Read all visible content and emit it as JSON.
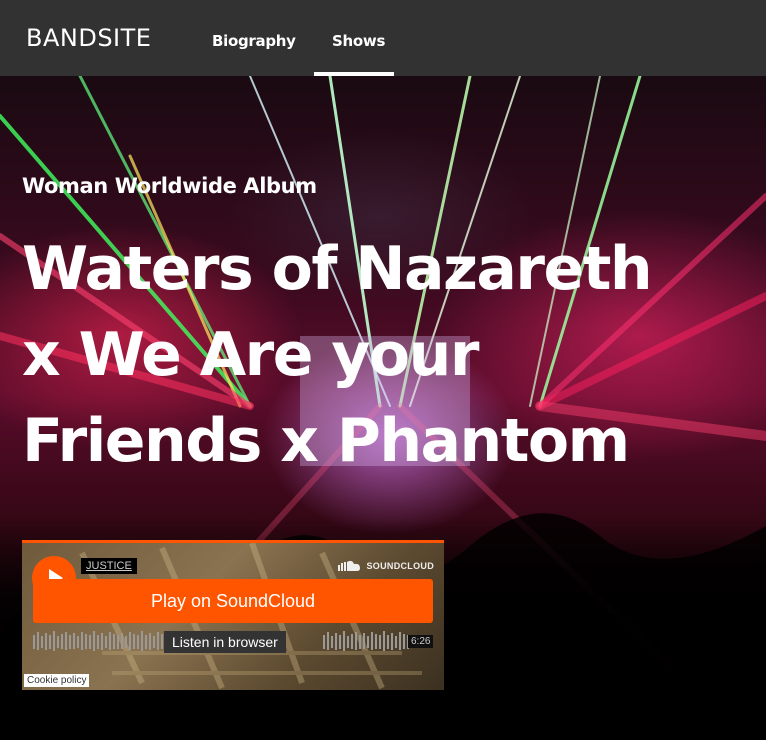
{
  "nav": {
    "logo": "BANDSITE",
    "links": [
      {
        "label": "Biography"
      },
      {
        "label": "Shows"
      }
    ]
  },
  "hero": {
    "subtitle": "Woman Worldwide Album",
    "title_lines": [
      "Waters of Nazareth",
      "x We Are your",
      "Friends x Phantom"
    ]
  },
  "soundcloud": {
    "artist": "JUSTICE",
    "brand": "SOUNDCLOUD",
    "play_button": "Play on SoundCloud",
    "listen_button": "Listen in browser",
    "duration": "6:26",
    "cookie_policy": "Cookie policy"
  },
  "colors": {
    "nav_bg": "#323232",
    "soundcloud_orange": "#ff5500"
  }
}
